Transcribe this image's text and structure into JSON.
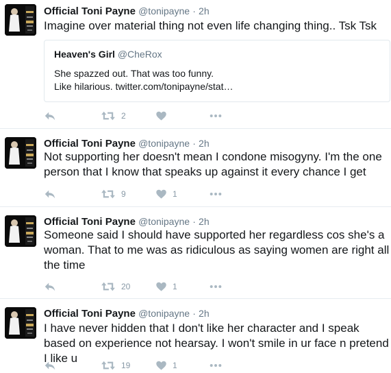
{
  "tweets": [
    {
      "name": "Official Toni Payne",
      "handle": "@tonipayne",
      "dot": "·",
      "time": "2h",
      "text": "Imagine over material thing not even life changing thing.. Tsk Tsk",
      "quote": {
        "name": "Heaven's Girl",
        "handle": "@CheRox",
        "line1": "She spazzed out. That was too funny.",
        "line2": "Like hilarious. twitter.com/tonipayne/stat…"
      },
      "retweets": "2",
      "likes": ""
    },
    {
      "name": "Official Toni Payne",
      "handle": "@tonipayne",
      "dot": "·",
      "time": "2h",
      "text": "Not supporting her doesn't mean I condone misogyny. I'm the one person that I know that speaks up against it every chance I get",
      "retweets": "9",
      "likes": "1"
    },
    {
      "name": "Official Toni Payne",
      "handle": "@tonipayne",
      "dot": "·",
      "time": "2h",
      "text": "Someone said I should have supported her regardless cos she's a woman. That to me was as ridiculous as saying women are right all the time",
      "retweets": "20",
      "likes": "1"
    },
    {
      "name": "Official Toni Payne",
      "handle": "@tonipayne",
      "dot": "·",
      "time": "2h",
      "text": "I have never hidden that I don't like her character and I speak based on experience not hearsay. I won't smile in ur face n pretend I like u",
      "retweets": "19",
      "likes": "1"
    }
  ],
  "icons": {
    "reply": "reply-icon",
    "retweet": "retweet-icon",
    "like": "heart-icon",
    "more": "more-icon"
  },
  "colors": {
    "text": "#14171a",
    "secondary": "#657786",
    "action": "#aab8c2",
    "border": "#e6ecf0"
  }
}
